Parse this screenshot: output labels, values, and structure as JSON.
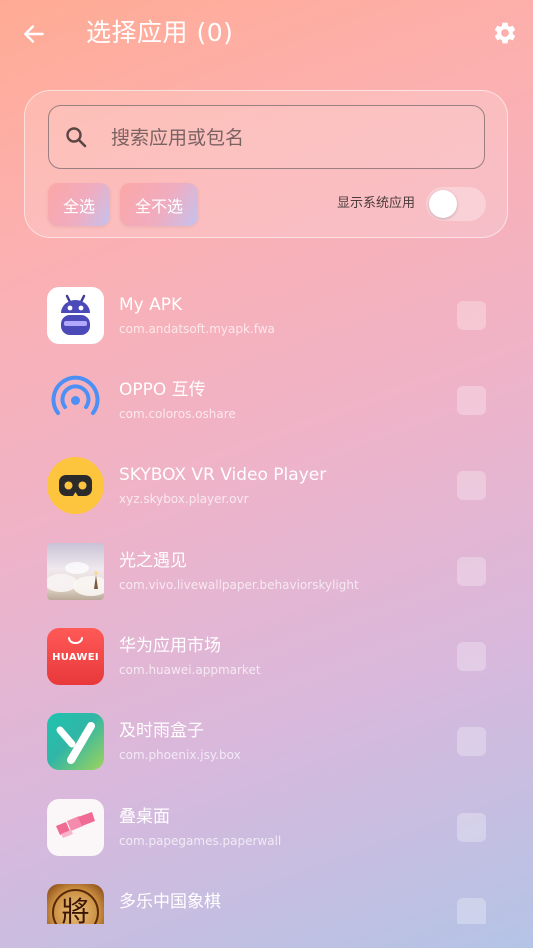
{
  "header": {
    "title": "选择应用 (0)",
    "back_icon": "arrow-left-icon",
    "settings_icon": "gear-icon"
  },
  "filter": {
    "search_placeholder": "搜索应用或包名",
    "search_value": "",
    "select_all_label": "全选",
    "deselect_all_label": "全不选",
    "show_system_apps_label": "显示系统应用",
    "show_system_apps_on": false
  },
  "apps": [
    {
      "name": "My APK",
      "package": "com.andatsoft.myapk.fwa",
      "icon": "myapk-robot-icon",
      "checked": false
    },
    {
      "name": "OPPO 互传",
      "package": "com.coloros.oshare",
      "icon": "oppo-share-icon",
      "checked": false
    },
    {
      "name": "SKYBOX VR Video Player",
      "package": "xyz.skybox.player.ovr",
      "icon": "vr-headset-icon",
      "checked": false
    },
    {
      "name": "光之遇见",
      "package": "com.vivo.livewallpaper.behaviorskylight",
      "icon": "sky-wallpaper-icon",
      "checked": false
    },
    {
      "name": "华为应用市场",
      "package": "com.huawei.appmarket",
      "icon": "huawei-appgallery-icon",
      "icon_text": "HUAWEI",
      "checked": false
    },
    {
      "name": "及时雨盒子",
      "package": "com.phoenix.jsy.box",
      "icon": "jsy-box-icon",
      "checked": false
    },
    {
      "name": "叠桌面",
      "package": "com.papegames.paperwall",
      "icon": "paperwall-icon",
      "checked": false
    },
    {
      "name": "多乐中国象棋",
      "package": "",
      "icon": "chinese-chess-icon",
      "icon_text": "將",
      "checked": false
    }
  ]
}
